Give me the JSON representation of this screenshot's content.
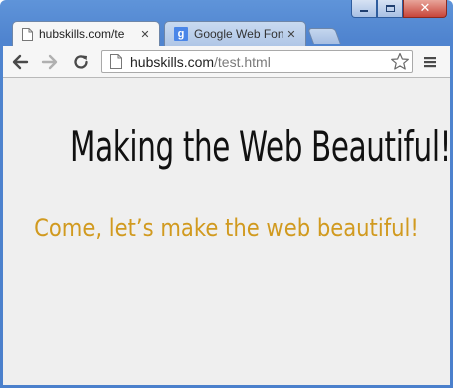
{
  "window": {
    "controls": {
      "minimize_icon": "minimize-icon",
      "maximize_icon": "maximize-icon",
      "close_icon": "close-icon",
      "close_glyph": "✕"
    }
  },
  "tabs": [
    {
      "title": "hubskills.com/te",
      "active": true,
      "favicon": "page-icon",
      "close": "✕"
    },
    {
      "title": "Google Web Fon",
      "active": false,
      "favicon": "google-icon",
      "favicon_letter": "g",
      "close": "✕"
    }
  ],
  "toolbar": {
    "url_host": "hubskills.com",
    "url_path": "/test.html",
    "back_icon": "back-arrow-icon",
    "forward_icon": "forward-arrow-icon",
    "reload_icon": "reload-icon",
    "star_icon": "star-icon",
    "menu_icon": "menu-icon"
  },
  "page": {
    "heading": "Making the Web Beautiful!",
    "subheading": "Come, let’s make the web beautiful!",
    "subheading_color": "#d19a1f",
    "background_color": "#efefef"
  },
  "colors": {
    "frame": "#4f84cf",
    "close_button": "#c8453a"
  }
}
